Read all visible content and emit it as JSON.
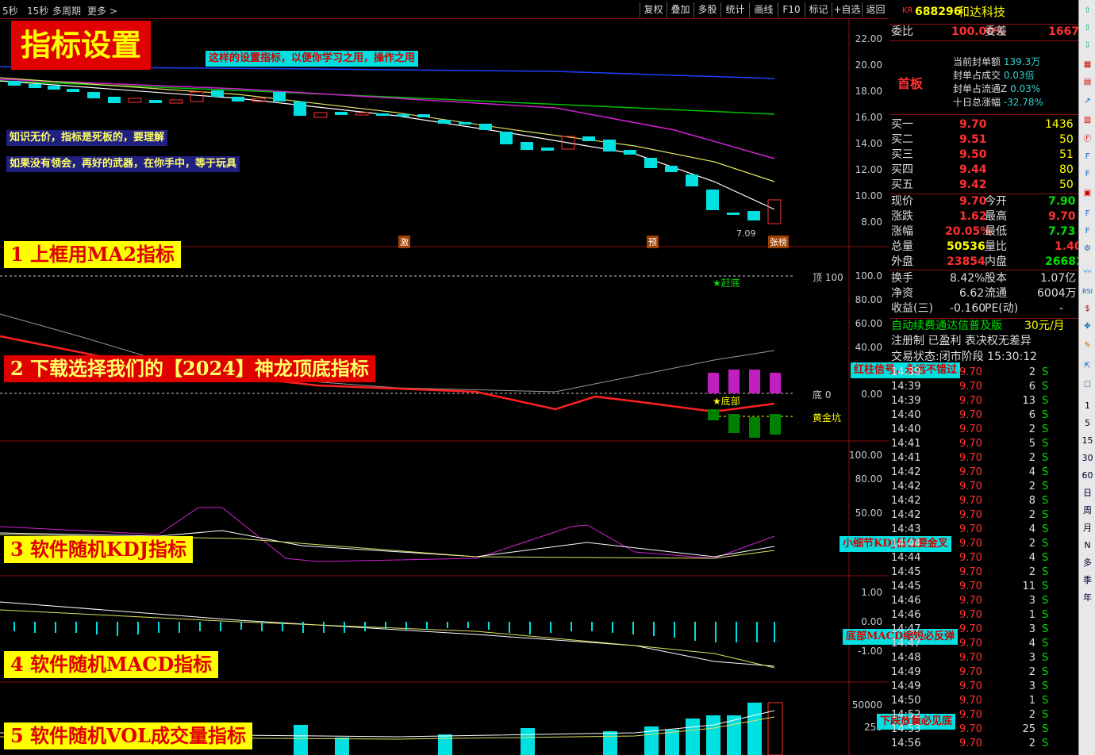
{
  "toolbar": {
    "periods": [
      "5秒",
      "15秒",
      "多周期",
      "更多 >"
    ],
    "buttons": [
      "复权",
      "叠加",
      "多股",
      "统计",
      "画线",
      "F10",
      "标记",
      "+自选",
      "返回"
    ]
  },
  "title": "指标设置",
  "notes": {
    "n1": "这样的设置指标，以便你学习之用，操作之用",
    "n2": "知识无价，指标是死板的，要理解",
    "n3": "如果没有领会，再好的武器，在你手中，等于玩具"
  },
  "steps": {
    "s1": "1  上框用MA2指标",
    "s2": "2   下载选择我们的【2024】神龙顶底指标",
    "s3": "3   软件随机KDJ指标",
    "s4": "4   软件随机MACD指标",
    "s5": "5   软件随机VOL成交量指标"
  },
  "callouts": {
    "c1": "红柱信号，永远不错过",
    "c2": "小细节KDJ低位要金叉",
    "c3": "底部MACD缩短必反弹",
    "c4": "下跌放量必见底"
  },
  "chart_marks": {
    "low": "7.09",
    "jian": "激",
    "yu": "预",
    "zhangbang": "张榜",
    "top100": "顶 100",
    "bottom0": "底 0",
    "gold": "黄金坑",
    "gandi": "★赶底",
    "dibu": "★底部"
  },
  "price_axis": [
    "22.00",
    "20.00",
    "18.00",
    "16.00",
    "14.00",
    "12.00",
    "10.00",
    "8.00"
  ],
  "ind_axis": [
    "100.0",
    "80.00",
    "60.00",
    "40.00",
    "0.00"
  ],
  "kdj_axis": [
    "100.00",
    "80.00",
    "50.00"
  ],
  "macd_axis": [
    "1.00",
    "0.00",
    "-1.00"
  ],
  "vol_axis": [
    "50000",
    "250"
  ],
  "quote": {
    "code_prefix": "KR",
    "code": "688296",
    "name": "和达科技",
    "weibi_l": "委比",
    "weibi": "100.00%",
    "weicha_l": "委差",
    "weicha": "1667",
    "shouban": "首板",
    "seal": [
      "当前封单额",
      "139.3万",
      "封单占成交",
      "0.03倍",
      "封单占流通Z",
      "0.03%",
      "十日总涨幅",
      "-32.78%"
    ],
    "buy": [
      [
        "买一",
        "9.70",
        "1436"
      ],
      [
        "买二",
        "9.51",
        "50"
      ],
      [
        "买三",
        "9.50",
        "51"
      ],
      [
        "买四",
        "9.44",
        "80"
      ],
      [
        "买五",
        "9.42",
        "50"
      ]
    ],
    "stats": [
      [
        "现价",
        "9.70",
        "今开",
        "7.90"
      ],
      [
        "涨跌",
        "1.62",
        "最高",
        "9.70"
      ],
      [
        "涨幅",
        "20.05%",
        "最低",
        "7.73"
      ],
      [
        "总量",
        "50536",
        "量比",
        "1.40"
      ],
      [
        "外盘",
        "23854",
        "内盘",
        "26682"
      ]
    ],
    "stats2": [
      [
        "换手",
        "8.42%",
        "股本",
        "1.07亿"
      ],
      [
        "净资",
        "6.62",
        "流通",
        "6004万"
      ],
      [
        "收益(三)",
        "-0.160",
        "PE(动)",
        "-"
      ]
    ],
    "ad1": "自动续费通达信普及版",
    "ad1b": "30元/月",
    "ad2": "注册制 已盈利 表决权无差异",
    "status": "交易状态:闭市阶段 15:30:12",
    "ticks": [
      [
        "14:39",
        "9.70",
        "2",
        "S"
      ],
      [
        "14:39",
        "9.70",
        "6",
        "S"
      ],
      [
        "14:39",
        "9.70",
        "13",
        "S"
      ],
      [
        "14:40",
        "9.70",
        "6",
        "S"
      ],
      [
        "14:40",
        "9.70",
        "2",
        "S"
      ],
      [
        "14:41",
        "9.70",
        "5",
        "S"
      ],
      [
        "14:41",
        "9.70",
        "2",
        "S"
      ],
      [
        "14:42",
        "9.70",
        "4",
        "S"
      ],
      [
        "14:42",
        "9.70",
        "2",
        "S"
      ],
      [
        "14:42",
        "9.70",
        "8",
        "S"
      ],
      [
        "14:42",
        "9.70",
        "2",
        "S"
      ],
      [
        "14:43",
        "9.70",
        "4",
        "S"
      ],
      [
        "14:44",
        "9.70",
        "2",
        "S"
      ],
      [
        "14:44",
        "9.70",
        "4",
        "S"
      ],
      [
        "14:45",
        "9.70",
        "2",
        "S"
      ],
      [
        "14:45",
        "9.70",
        "11",
        "S"
      ],
      [
        "14:46",
        "9.70",
        "3",
        "S"
      ],
      [
        "14:46",
        "9.70",
        "1",
        "S"
      ],
      [
        "14:47",
        "9.70",
        "3",
        "S"
      ],
      [
        "14:47",
        "9.70",
        "4",
        "S"
      ],
      [
        "14:48",
        "9.70",
        "3",
        "S"
      ],
      [
        "14:49",
        "9.70",
        "2",
        "S"
      ],
      [
        "14:49",
        "9.70",
        "3",
        "S"
      ],
      [
        "14:50",
        "9.70",
        "1",
        "S"
      ],
      [
        "14:52",
        "9.70",
        "2",
        "S"
      ],
      [
        "14:53",
        "9.70",
        "25",
        "S"
      ],
      [
        "14:56",
        "9.70",
        "2",
        "S"
      ]
    ]
  },
  "side_icons": [
    "1",
    "5",
    "15",
    "30",
    "60",
    "日",
    "周",
    "月",
    "N",
    "多",
    "季",
    "年"
  ]
}
